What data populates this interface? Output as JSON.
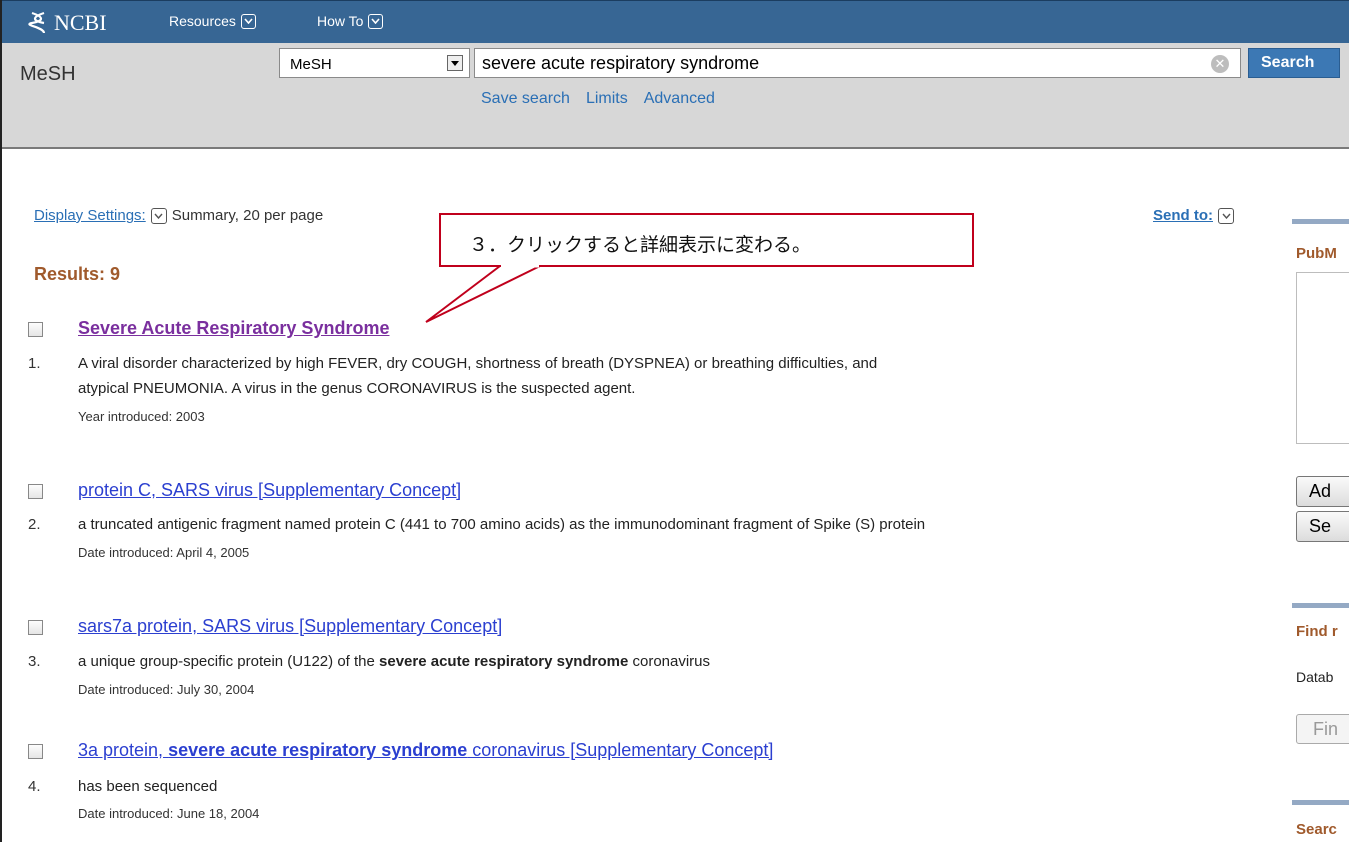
{
  "header": {
    "logo": "NCBI",
    "nav": [
      {
        "label": "Resources"
      },
      {
        "label": "How To"
      }
    ]
  },
  "search": {
    "db_title": "MeSH",
    "db_select": "MeSH",
    "term": "severe acute respiratory syndrome",
    "button": "Search",
    "links": [
      "Save search",
      "Limits",
      "Advanced"
    ]
  },
  "results": {
    "display_settings_label": "Display Settings:",
    "display_settings_value": "Summary, 20 per page",
    "send_to": "Send to:",
    "count_label": "Results: 9",
    "items": [
      {
        "num": "1.",
        "title": "Severe Acute Respiratory Syndrome",
        "desc_lines": [
          "A viral disorder characterized by high FEVER, dry COUGH, shortness of breath (DYSPNEA) or breathing difficulties, and",
          "atypical PNEUMONIA. A virus in the genus CORONAVIRUS is the suspected agent."
        ],
        "meta": "Year introduced: 2003"
      },
      {
        "num": "2.",
        "title": "protein C, SARS virus [Supplementary Concept]",
        "desc_lines": [
          "a truncated antigenic fragment named protein C (441 to 700 amino acids) as the immunodominant fragment of Spike (S) protein"
        ],
        "meta": "Date introduced: April 4, 2005"
      },
      {
        "num": "3.",
        "title": "sars7a protein, SARS virus [Supplementary Concept]",
        "desc_pre": "a unique group-specific protein (U122) of the ",
        "desc_bold": "severe acute respiratory syndrome",
        "desc_post": " coronavirus",
        "meta": "Date introduced: July 30, 2004"
      },
      {
        "num": "4.",
        "title_pre": "3a protein, ",
        "title_bold": "severe acute respiratory syndrome",
        "title_post": " coronavirus [Supplementary Concept]",
        "desc": "has been sequenced",
        "meta": "Date introduced: June 18, 2004"
      }
    ]
  },
  "annotation": {
    "text": "３．クリックすると詳細表示に変わる。",
    "color": "#c0001c"
  },
  "sidebar": {
    "pubmed_label": "PubM",
    "add_button": "Ad",
    "search_button": "Se",
    "find_label": "Find r",
    "database_label": "Datab",
    "find_button": "Fin",
    "search_label": "Searc"
  }
}
